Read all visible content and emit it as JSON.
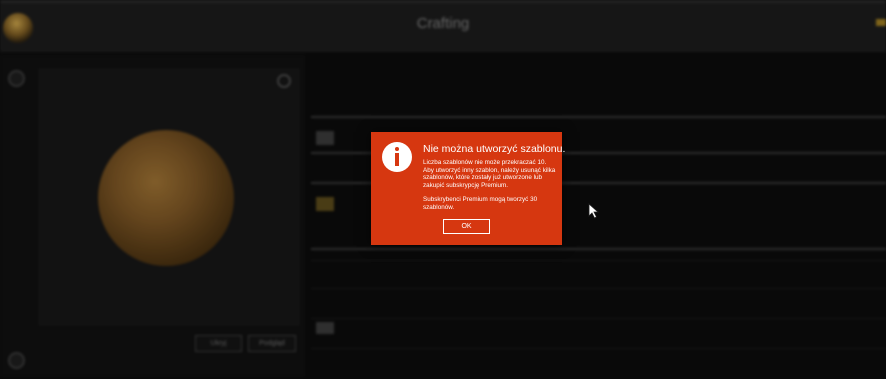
{
  "topbar": {
    "title": "Crafting"
  },
  "preview": {
    "cancel_label": "Ukryj",
    "preview_label": "Podgląd"
  },
  "modal": {
    "title": "Nie można utworzyć szablonu.",
    "message": "Liczba szablonów nie może przekraczać 10. Aby utworzyć inny szablon, należy usunąć kilka szablonów, które zostały już utworzone lub zakupić subskrypcję Premium.",
    "premium_note": "Subskrybenci Premium mogą tworzyć 30 szablonów.",
    "ok_label": "OK",
    "accent_color": "#d63710"
  },
  "icons": [
    "info-icon",
    "mouse-cursor-icon"
  ]
}
